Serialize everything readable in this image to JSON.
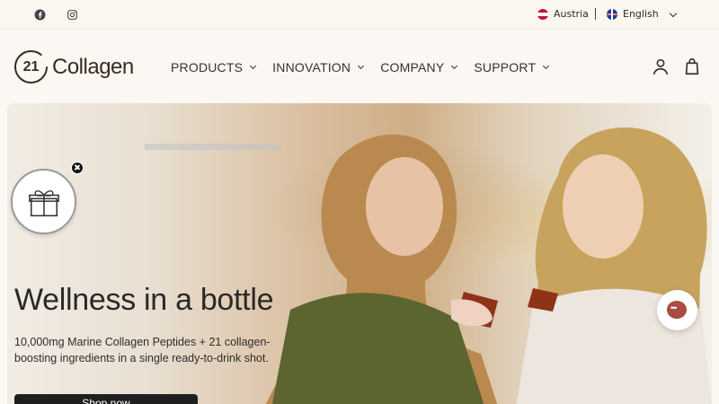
{
  "topbar": {
    "social": [
      "facebook-icon",
      "instagram-icon"
    ],
    "country": "Austria",
    "language": "English"
  },
  "brand": {
    "mark": "21",
    "name": "Collagen"
  },
  "nav": {
    "items": [
      {
        "label": "PRODUCTS"
      },
      {
        "label": "INNOVATION"
      },
      {
        "label": "COMPANY"
      },
      {
        "label": "SUPPORT"
      }
    ]
  },
  "hero": {
    "title": "Wellness in a bottle",
    "description": "10,000mg Marine Collagen Peptides + 21 collagen-boosting ingredients in a single ready-to-drink shot.",
    "cta": "Shop now"
  },
  "colors": {
    "accent": "#a84d3f",
    "dark": "#1f1f1f",
    "background": "#fbf8f3"
  }
}
